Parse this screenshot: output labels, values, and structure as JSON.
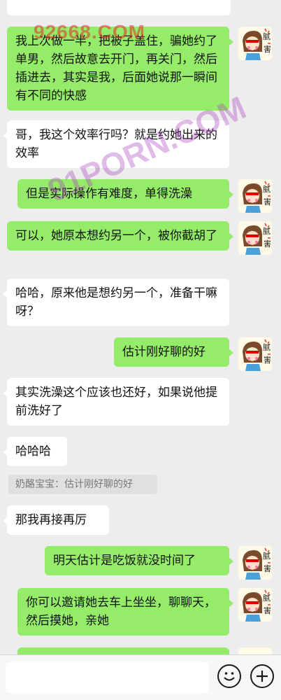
{
  "messages": [
    {
      "side": "out",
      "text": "我上次做一半，把被子盖住，骗她约了单男，然后故意去开门，再关门，然后插进去，其实是我，后面她说那一瞬间有不同的快感"
    },
    {
      "side": "in",
      "text": "哥，我这个效率行吗？就是约她出来的效率"
    },
    {
      "side": "out",
      "text": "但是实际操作有难度，单得洗澡"
    },
    {
      "side": "out",
      "text": "可以，她原本想约另一个，被你截胡了"
    },
    {
      "side": "in",
      "text": "哈哈，原来他是想约另一个，准备干嘛呀？"
    },
    {
      "side": "out",
      "text": "估计刚好聊的好"
    },
    {
      "side": "in",
      "text": "其实洗澡这个应该也还好，如果说他提前洗好了"
    },
    {
      "side": "in",
      "text": "哈哈哈"
    },
    {
      "side": "in",
      "text": "那我再接再厉"
    },
    {
      "side": "out",
      "text": "明天估计是吃饭就没时间了"
    },
    {
      "side": "out",
      "text": "你可以邀请她去车上坐坐，聊聊天，然后摸她，亲她"
    }
  ],
  "quote": "奶酪宝宝：估计刚好聊的好",
  "avatar_label": "腻害",
  "watermarks": [
    "92668.COM",
    "91PORN.COM"
  ],
  "icons": {
    "emoji": "smiley-icon",
    "add": "plus-icon"
  },
  "colors": {
    "out_bubble": "#95ec69",
    "in_bubble": "#ffffff",
    "background": "#ededed"
  }
}
